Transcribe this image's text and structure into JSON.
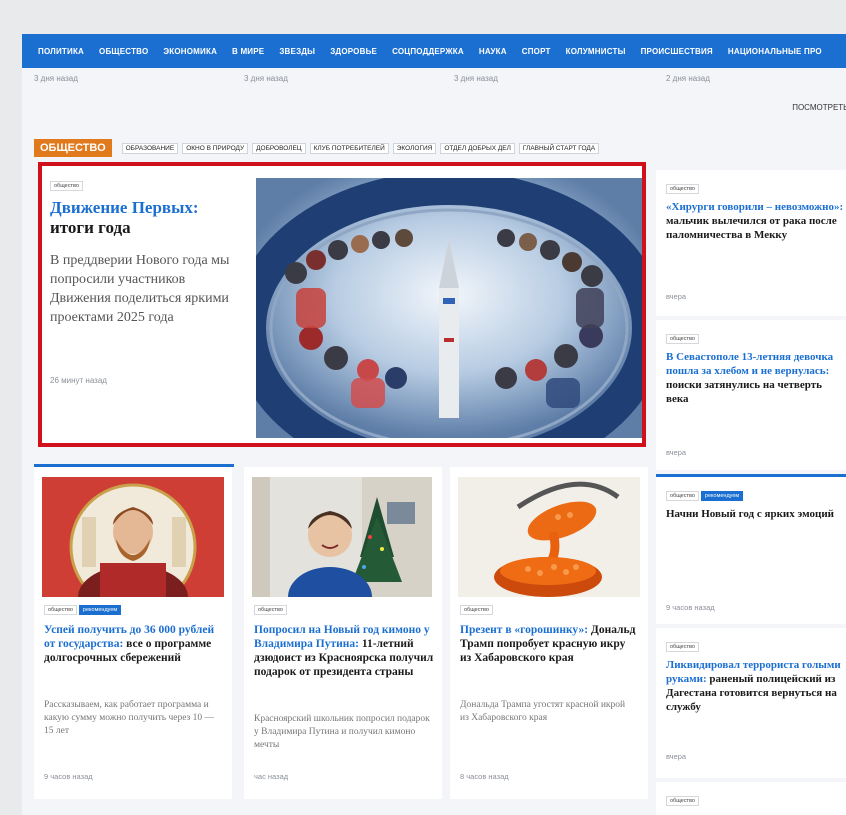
{
  "nav": [
    "ПОЛИТИКА",
    "ОБЩЕСТВО",
    "ЭКОНОМИКА",
    "В МИРЕ",
    "ЗВЕЗДЫ",
    "ЗДОРОВЬЕ",
    "СОЦПОДДЕРЖКА",
    "НАУКА",
    "СПОРТ",
    "КОЛУМНИСТЫ",
    "ПРОИСШЕСТВИЯ",
    "НАЦИОНАЛЬНЫЕ ПРО"
  ],
  "prev_times": [
    "3 дня назад",
    "3 дня назад",
    "3 дня назад",
    "2 дня назад"
  ],
  "see_all": "ПОСМОТРЕТЬ В",
  "section": {
    "title": "ОБЩЕСТВО",
    "subsections": [
      "ОБРАЗОВАНИЕ",
      "ОКНО В ПРИРОДУ",
      "ДОБРОВОЛЕЦ",
      "КЛУБ ПОТРЕБИТЕЛЕЙ",
      "ЭКОЛОГИЯ",
      "ОТДЕЛ ДОБРЫХ ДЕЛ",
      "ГЛАВНЫЙ СТАРТ ГОДА"
    ]
  },
  "feature": {
    "tag": "общество",
    "title_blue": "Движение Первых:",
    "title_black": "итоги года",
    "lead": "В преддверии Нового года мы попросили участников Движения поделиться яркими проектами 2025 года",
    "time": "26 минут назад"
  },
  "cards": [
    {
      "tags": [
        "общество",
        "рекомендуем"
      ],
      "title_blue": "Успей получить до 36 000 рублей от государства:",
      "title_black": " все о программе долгосрочных сбережений",
      "lead": "Рассказываем, как работает программа и какую сумму можно получить через 10 — 15 лет",
      "time": "9 часов назад"
    },
    {
      "tags": [
        "общество"
      ],
      "title_blue": "Попросил на Новый год кимоно у Владимира Путина:",
      "title_black": " 11-летний дзюдоист из Красноярска получил подарок от президента страны",
      "lead": "Красноярский школьник попросил подарок у Владимира Путина и получил кимоно мечты",
      "time": "час назад"
    },
    {
      "tags": [
        "общество"
      ],
      "title_blue": "Презент в «горошинку»:",
      "title_black": " Дональд Трамп попробует красную икру из Хабаровского края",
      "lead": "Дональда Трампа угостят красной икрой из Хабаровского края",
      "time": "8 часов назад"
    }
  ],
  "side": [
    {
      "tags": [
        "общество"
      ],
      "title_blue": "«Хирурги говорили – невозможно»:",
      "title_black": " мальчик вылечился от рака после паломничества в Мекку",
      "time": "вчера"
    },
    {
      "tags": [
        "общество"
      ],
      "title_blue": "В Севастополе 13-летняя девочка пошла за хлебом и не вернулась:",
      "title_black": " поиски затянулись на четверть века",
      "time": "вчера"
    },
    {
      "tags": [
        "общество",
        "рекомендуем"
      ],
      "title_blue": "",
      "title_black": "Начни Новый год с ярких эмоций",
      "time": "9 часов назад"
    },
    {
      "tags": [
        "общество"
      ],
      "title_blue": "Ликвидировал террориста голыми руками:",
      "title_black": " раненый полицейский из Дагестана готовится вернуться на службу",
      "time": "вчера"
    },
    {
      "tags": [
        "общество"
      ],
      "title_blue": "",
      "title_black": "",
      "time": ""
    }
  ],
  "colors": {
    "nav_blue": "#1b6fd1",
    "section_orange": "#e07a1c",
    "highlight_red": "#d0101a"
  }
}
